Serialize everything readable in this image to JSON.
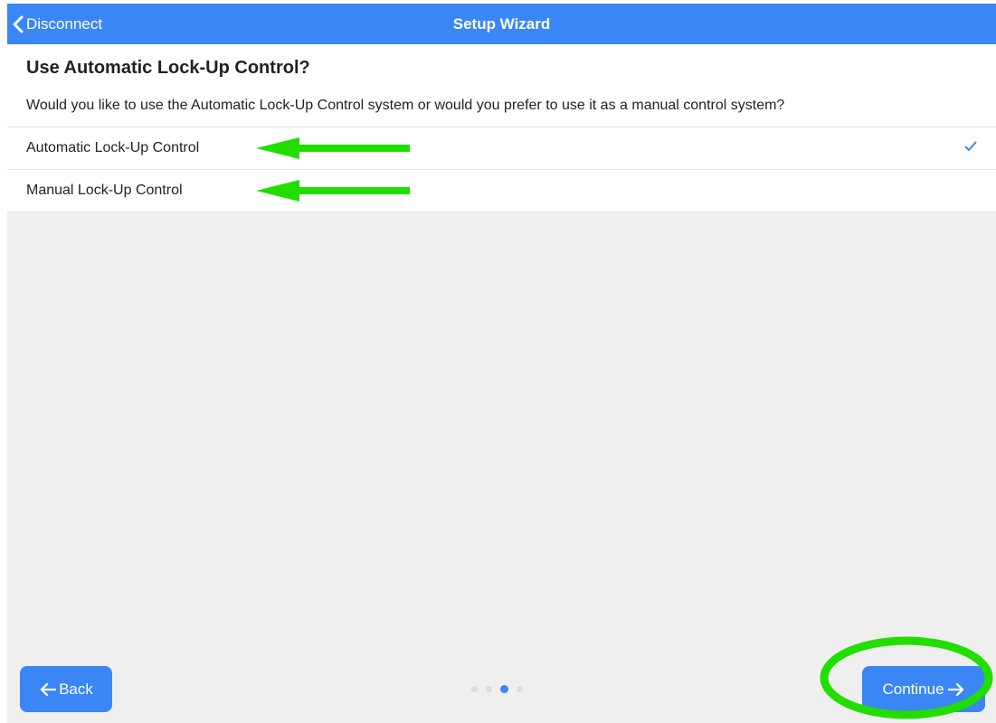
{
  "nav": {
    "back_label": "Disconnect",
    "title": "Setup Wizard"
  },
  "question": {
    "title": "Use Automatic Lock-Up Control?",
    "description": "Would you like to use the Automatic Lock-Up Control system or would you prefer to use it as a manual control system?"
  },
  "options": [
    {
      "label": "Automatic Lock-Up Control",
      "selected": true
    },
    {
      "label": "Manual Lock-Up Control",
      "selected": false
    }
  ],
  "footer": {
    "back_label": "Back",
    "continue_label": "Continue",
    "pager": {
      "total": 4,
      "current": 3
    }
  },
  "colors": {
    "accent": "#3a86f5",
    "annotation": "#22dd00",
    "background": "#efefef"
  },
  "icons": {
    "nav_back": "chevron-left-icon",
    "check": "checkmark-icon",
    "back": "arrow-left-icon",
    "continue": "arrow-right-icon"
  }
}
